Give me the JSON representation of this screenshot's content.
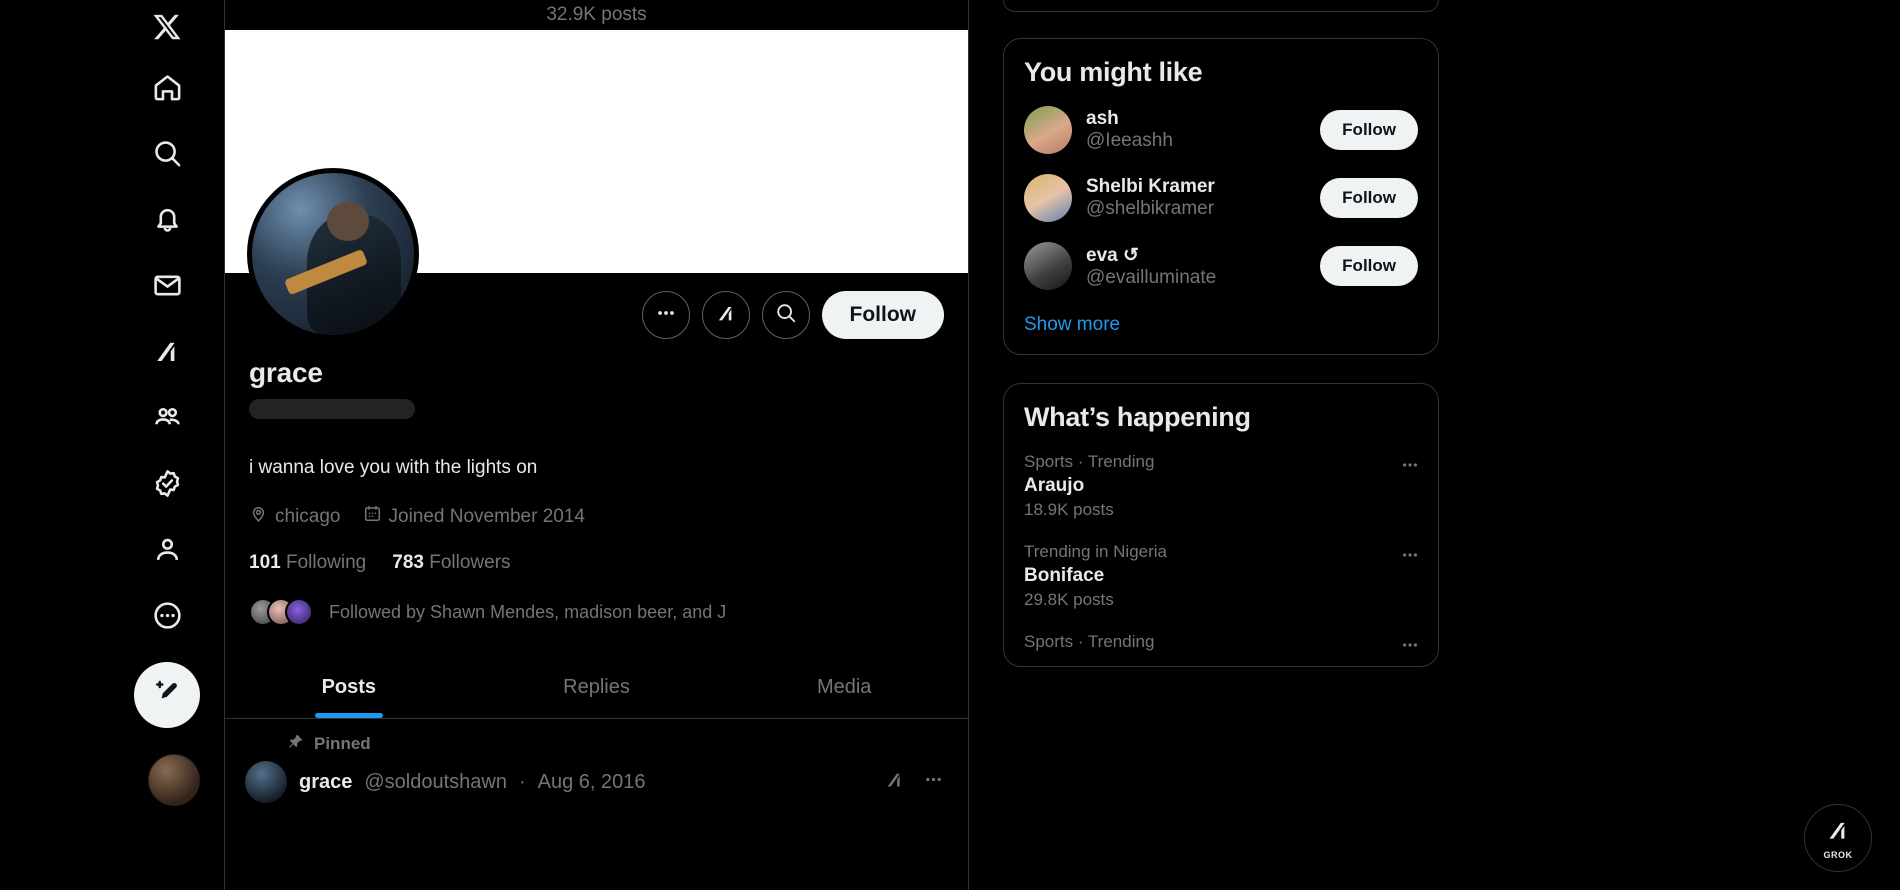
{
  "app": {
    "name": "X",
    "theme_background": "#000000",
    "accent": "#1d9bf0",
    "button_fg": "#eff3f4"
  },
  "left_nav": {
    "items": [
      {
        "label": "X",
        "icon": "x-logo-icon"
      },
      {
        "label": "Home",
        "icon": "home-icon"
      },
      {
        "label": "Explore",
        "icon": "search-icon"
      },
      {
        "label": "Notifications",
        "icon": "bell-icon"
      },
      {
        "label": "Messages",
        "icon": "mail-icon"
      },
      {
        "label": "Grok",
        "icon": "grok-icon"
      },
      {
        "label": "Communities",
        "icon": "communities-icon"
      },
      {
        "label": "Premium",
        "icon": "verified-badge-icon"
      },
      {
        "label": "Profile",
        "icon": "person-icon"
      },
      {
        "label": "More",
        "icon": "more-circle-icon"
      }
    ],
    "compose_icon": "compose-post-icon"
  },
  "header": {
    "post_count": "32.9K posts"
  },
  "profile": {
    "display_name": "grace",
    "handle_redacted": true,
    "bio": "i wanna love you with the lights on",
    "location": "chicago",
    "location_icon": "location-pin-icon",
    "joined": "Joined November 2014",
    "joined_icon": "calendar-icon",
    "following_count": "101",
    "following_label": "Following",
    "followers_count": "783",
    "followers_label": "Followers",
    "followed_by": "Followed by Shawn Mendes, madison beer, and J",
    "actions": {
      "more_icon": "more-horizontal-icon",
      "grok_icon": "grok-icon",
      "search_icon": "search-icon",
      "follow_label": "Follow"
    }
  },
  "tabs": [
    {
      "label": "Posts",
      "active": true
    },
    {
      "label": "Replies",
      "active": false
    },
    {
      "label": "Media",
      "active": false
    }
  ],
  "pinned_post": {
    "pinned_label": "Pinned",
    "pinned_icon": "pin-icon",
    "author_name": "grace",
    "author_handle": "@soldoutshawn",
    "separator": "·",
    "date": "Aug 6, 2016",
    "grok_icon": "grok-icon",
    "more_icon": "more-horizontal-icon"
  },
  "right_sidebar": {
    "you_might_like": {
      "title": "You might like",
      "suggestions": [
        {
          "name": "ash",
          "handle": "@Ieeashh",
          "follow_label": "Follow",
          "avatar": "av-ash",
          "emoji": ""
        },
        {
          "name": "Shelbi Kramer",
          "handle": "@shelbikramer",
          "follow_label": "Follow",
          "avatar": "av-shelbi",
          "emoji": ""
        },
        {
          "name": "eva",
          "handle": "@evailluminate",
          "follow_label": "Follow",
          "avatar": "av-eva",
          "emoji": "↺"
        }
      ],
      "show_more": "Show more"
    },
    "whats_happening": {
      "title": "What’s happening",
      "trends": [
        {
          "category": "Sports · Trending",
          "name": "Araujo",
          "posts": "18.9K posts",
          "more_icon": "more-horizontal-icon"
        },
        {
          "category": "Trending in Nigeria",
          "name": "Boniface",
          "posts": "29.8K posts",
          "more_icon": "more-horizontal-icon"
        },
        {
          "category": "Sports · Trending",
          "name": "",
          "posts": "",
          "more_icon": "more-horizontal-icon"
        }
      ]
    }
  },
  "grok_fab": {
    "label": "GROK",
    "icon": "grok-icon"
  }
}
